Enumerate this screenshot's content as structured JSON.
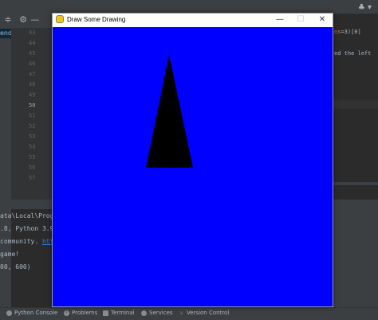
{
  "ide": {
    "project_item": "end",
    "line_numbers": [
      "43",
      "44",
      "45",
      "46",
      "47",
      "48",
      "49",
      "50",
      "51",
      "52",
      "53",
      "54",
      "55",
      "56",
      "57"
    ],
    "current_line": "50",
    "code_right_1_prefix": "ns",
    "code_right_1_suffix": "=3)[0]",
    "code_right_2": "ed the left",
    "console_lines": [
      "ata\\Local\\Prog",
      ".8, Python 3.9",
      "community. ",
      " game!",
      "00, 600)"
    ],
    "console_link": "htt",
    "status_items": [
      "Python Console",
      "Problems",
      "Terminal",
      "Services",
      "Version Control"
    ],
    "user_menu": "♣ ▾"
  },
  "window": {
    "title": "Draw Some Drawing",
    "minimize": "—",
    "maximize": "☐",
    "close": "✕",
    "background_color": "#0000ff",
    "shape_color": "#000000"
  },
  "colors": {
    "ide_bg": "#2b2b2b",
    "ide_panel": "#3c3f41",
    "link": "#287bde",
    "accent_red": "#cc7832"
  }
}
